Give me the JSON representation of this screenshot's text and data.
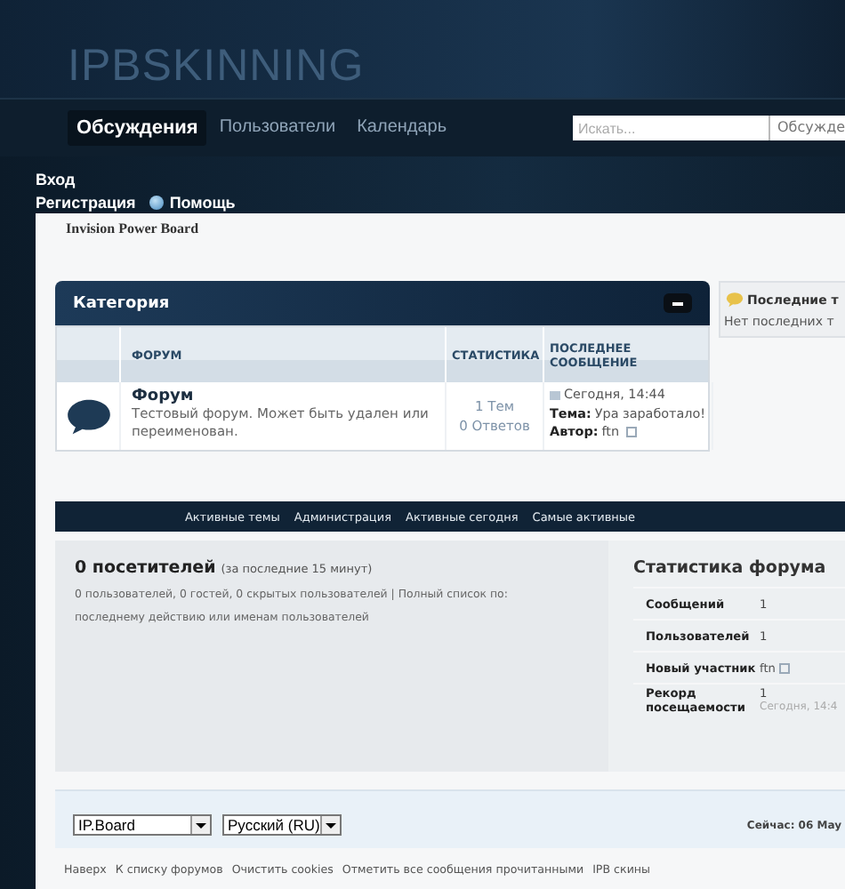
{
  "header": {
    "logo": "IPBSKINNING"
  },
  "nav": {
    "tabs": [
      {
        "label": "Обсуждения",
        "selected": true
      },
      {
        "label": "Пользователи",
        "selected": false
      },
      {
        "label": "Календарь",
        "selected": false
      }
    ],
    "search": {
      "placeholder": "Искать...",
      "scope": "Обсужде"
    }
  },
  "user_links": [
    {
      "label": "Вход",
      "kind": "plain"
    },
    {
      "label": "Регистрация",
      "kind": "plain"
    },
    {
      "label": "Помощь",
      "kind": "help"
    }
  ],
  "board_title": "Invision Power Board",
  "category": {
    "title": "Категория",
    "expanded": true,
    "columns": [
      "ФОРУМ",
      "СТАТИСТИКА",
      "ПОСЛЕДНЕЕ СООБЩЕНИЕ"
    ],
    "forums": [
      {
        "name": "Форум",
        "description": "Тестовый форум. Может быть удален или переименован.",
        "topics": "1 Тем",
        "replies": "0 Ответов",
        "last_date": "Сегодня, 14:44",
        "topic_label": "Тема:",
        "topic": "Ура заработало!",
        "author_label": "Автор:",
        "author": "ftn"
      }
    ]
  },
  "sidebar": {
    "title": "Последние т",
    "text": "Нет последних т"
  },
  "board_links": [
    "Активные темы",
    "Администрация",
    "Активные сегодня",
    "Самые активные"
  ],
  "online": {
    "title": "0 посетителей",
    "period": "(за последние 15 минут)",
    "text": "0 пользователей, 0 гостей, 0 скрытых пользователей | Полный список по: последнему действию или именам пользователей"
  },
  "stats": {
    "title": "Статистика форума",
    "rows": [
      {
        "kind": "plain",
        "label": "Сообщений",
        "value": "1"
      },
      {
        "kind": "plain",
        "label": "Пользователей",
        "value": "1"
      },
      {
        "kind": "user",
        "label": "Новый участник",
        "value": "ftn"
      },
      {
        "kind": "record",
        "label": "Рекорд посещаемости",
        "value": "1",
        "note": "Сегодня, 14:4"
      }
    ]
  },
  "footer": {
    "skin_select": "IP.Board",
    "language_select": "Русский (RU)",
    "time": "Сейчас: 06 May"
  },
  "bottom_links": [
    "Наверх",
    "К списку форумов",
    "Очистить cookies",
    "Отметить все сообщения прочитанными",
    "IPB скины"
  ]
}
